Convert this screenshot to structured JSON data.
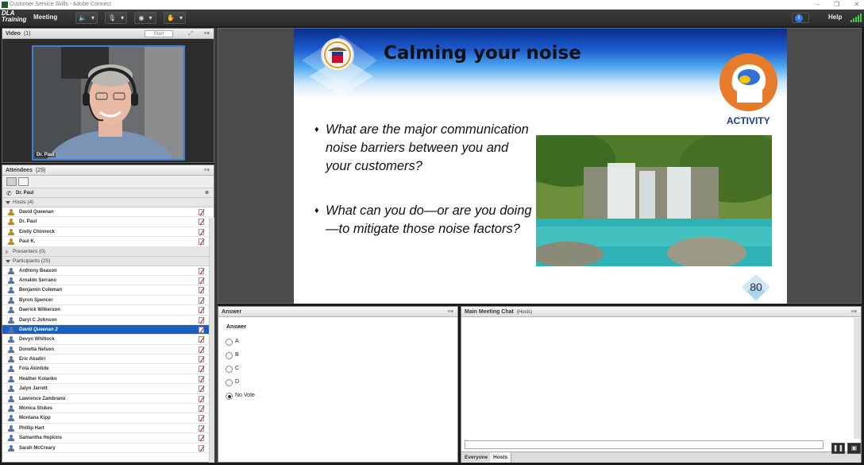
{
  "window": {
    "title": "Customer Service Skills - Adobe Connect"
  },
  "menubar": {
    "logo_line1": "DLA",
    "logo_line2": "Training",
    "meeting": "Meeting",
    "help": "Help"
  },
  "video": {
    "title": "Video",
    "count": "(1)",
    "start": "Start",
    "presenter_name": "Dr. Paul"
  },
  "attendees": {
    "title": "Attendees",
    "count": "(29)",
    "presenter": "Dr. Paul",
    "hosts_label": "Hosts (4)",
    "hosts": [
      "David Queenan",
      "Dr. Paul",
      "Emily Chinnock",
      "Paul K."
    ],
    "presenters_label": "Presenters (0)",
    "participants_label": "Participants (25)",
    "participants": [
      "Anthony Beason",
      "Arnaldo Serrano",
      "Benjamin Coleman",
      "Byron Spencer",
      "Daerick Wilkerson",
      "Daryl C Johnson",
      "David Queenan 2",
      "Devyn Whitlock",
      "Donetta Nelson",
      "Eric Akadiri",
      "Fola Akintide",
      "Heather Kolanko",
      "Jalyn Jarrett",
      "Lawrence Zambrano",
      "Monica Stukes",
      "Montana Kipp",
      "Phillip Hart",
      "Samantha Hopkins",
      "Sarah McCreary"
    ],
    "selected_index": 6
  },
  "slide": {
    "title": "Calming your noise",
    "badge": "ACTIVITY",
    "bullet1": "What are the major communication noise barriers between you and your customers?",
    "bullet2": "What can you do—or are you doing—to mitigate those noise factors?",
    "page": "80"
  },
  "poll": {
    "title": "Answer",
    "question": "Answer",
    "options": [
      "A",
      "B",
      "C",
      "D",
      "No Vote"
    ],
    "selected": "No Vote"
  },
  "chat": {
    "title": "Main Meeting Chat",
    "scope": "(Hosts)",
    "tabs": [
      "Everyone",
      "Hosts"
    ],
    "active_tab": "Hosts"
  },
  "colors": {
    "selection": "#1d5fbf",
    "slide_blue": "#1c5cd0",
    "activity": "#1a3b8c",
    "head_icon": "#e87a2c"
  }
}
